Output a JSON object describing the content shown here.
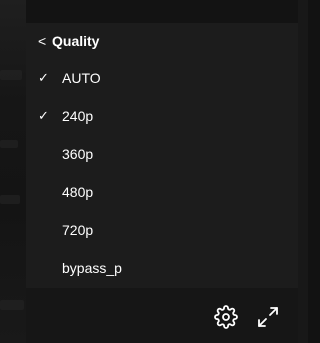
{
  "menu": {
    "header": {
      "back_glyph": "<",
      "title": "Quality"
    },
    "items": [
      {
        "label": "AUTO",
        "check": "✓"
      },
      {
        "label": "240p",
        "check": "✓"
      },
      {
        "label": "360p",
        "check": ""
      },
      {
        "label": "480p",
        "check": ""
      },
      {
        "label": "720p",
        "check": ""
      },
      {
        "label": "bypass_p",
        "check": ""
      }
    ]
  },
  "controls": {
    "settings_icon": "gear-icon",
    "fullscreen_icon": "expand-icon"
  },
  "colors": {
    "menu_bg": "#1c1c1c",
    "text": "#ffffff",
    "backdrop": "#121212"
  }
}
